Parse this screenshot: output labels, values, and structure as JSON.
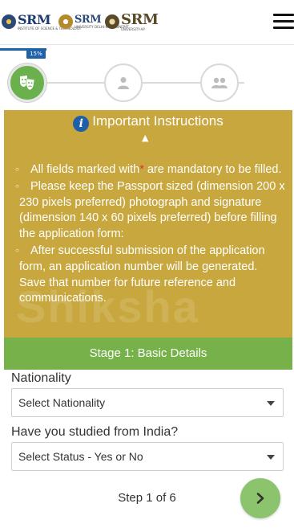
{
  "header": {
    "logos": [
      {
        "name": "SRM",
        "subtitle": "INSTITUTE OF SCIENCE & TECHNOLOGY"
      },
      {
        "name": "SRM",
        "subtitle": "UNIVERSITY DELHI-NCR, SONEPAT"
      },
      {
        "name": "SRM",
        "subtitle": "UNIVERSITY-AP"
      }
    ],
    "menu_icon": "hamburger-menu-icon"
  },
  "progress": {
    "percent_label": "15%",
    "percent": 15,
    "steps": [
      {
        "icon": "theater-masks-icon",
        "active": true
      },
      {
        "icon": "user-icon",
        "active": false
      },
      {
        "icon": "users-icon",
        "active": false
      }
    ]
  },
  "instructions": {
    "title": "Important Instructions",
    "items": [
      {
        "before": "All fields marked with",
        "star": "*",
        "after": " are mandatory to be filled."
      },
      {
        "text": "Please keep the Passport sized (dimension 200 x 230 pixels preferred) photograph and signature (dimension 140 x 60 pixels preferred) before filling the application form:"
      },
      {
        "text": "After successful submission of the application form, an application number will be generated. Save that number for future reference and communications."
      }
    ],
    "watermark": "Shiksha"
  },
  "stage": {
    "title": "Stage 1: Basic Details"
  },
  "form": {
    "nationality_label": "Nationality",
    "nationality_value": "Select Nationality",
    "studied_label": "Have you studied from India?",
    "studied_value": "Select Status - Yes or No"
  },
  "footer": {
    "step_text": "Step 1 of 6"
  },
  "colors": {
    "brand_blue": "#1e63a8",
    "instructions_bg": "#c8a83e",
    "stage_green": "#77b14a",
    "next_green": "#8cc46e"
  }
}
